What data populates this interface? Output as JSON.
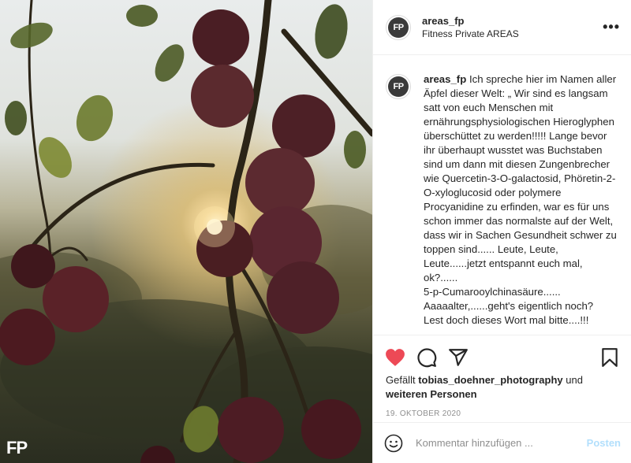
{
  "post": {
    "watermark": "FP",
    "account": {
      "username": "areas_fp",
      "subtitle": "Fitness Private AREAS",
      "avatar_text": "FP"
    },
    "more_icon": "more-horizontal-icon",
    "caption": {
      "username": "areas_fp",
      "text": "Ich spreche hier im Namen aller Äpfel dieser Welt: „ Wir sind es langsam satt von euch Menschen mit ernährungsphysiologischen Hieroglyphen überschüttet zu werden!!!!! Lange bevor ihr überhaupt wusstet was Buchstaben sind um dann mit diesen Zungenbrecher wie Quercetin-3-O-galactosid, Phöretin-2-O-xyloglucosid oder polymere Procyanidine zu erfinden, war es für uns schon immer das normalste auf der Welt, dass wir in Sachen Gesundheit schwer zu toppen sind...... Leute, Leute, Leute......jetzt entspannt euch mal, ok?......\n5-p-Cumarooylchinasäure......\nAaaaalter,......geht's eigentlich noch?\nLest doch dieses Wort mal bitte....!!!"
    },
    "actions": {
      "like_icon": "heart-filled-icon",
      "comment_icon": "comment-icon",
      "share_icon": "share-icon",
      "save_icon": "bookmark-icon"
    },
    "likes": {
      "prefix": "Gefällt ",
      "user": "tobias_doehner_photography",
      "middle": " und",
      "others": "weiteren Personen"
    },
    "date": "19. OKTOBER 2020",
    "comment": {
      "placeholder": "Kommentar hinzufügen ...",
      "post_label": "Posten",
      "emoji_icon": "smiley-icon"
    }
  },
  "colors": {
    "like_red": "#ed4956",
    "post_disabled_blue": "#b2dffc",
    "border": "#efefef"
  }
}
